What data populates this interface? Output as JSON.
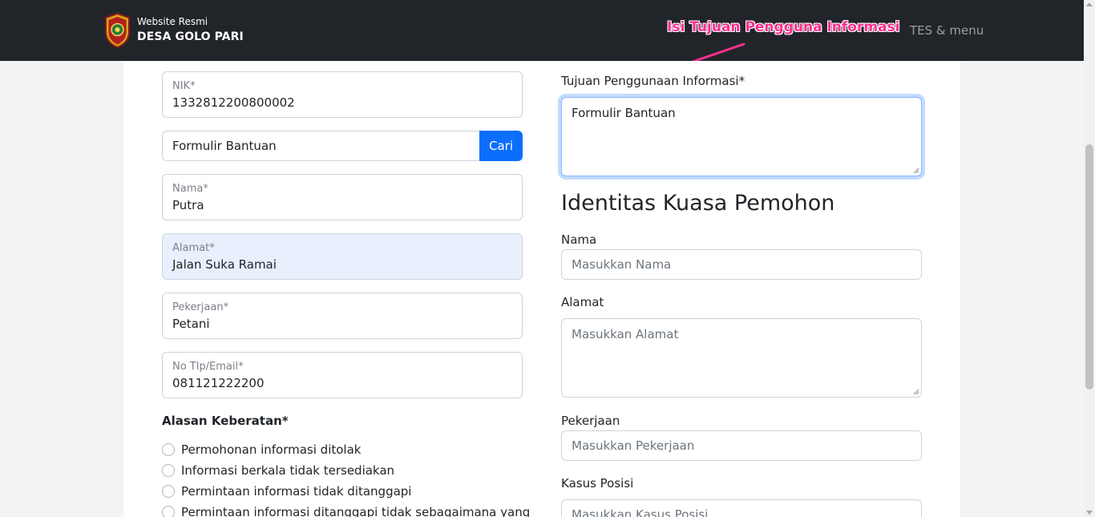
{
  "navbar": {
    "brand_small": "Website Resmi",
    "brand_big": "DESA GOLO PARI",
    "menu": "TES & menu"
  },
  "annotation": {
    "text": "Isi Tujuan Pengguna Informasi",
    "color": "#ff2d8f"
  },
  "left_form": {
    "nik": {
      "label": "NIK*",
      "value": "1332812200800002"
    },
    "search": {
      "value": "Formulir Bantuan",
      "button": "Cari"
    },
    "nama": {
      "label": "Nama*",
      "value": "Putra"
    },
    "alamat": {
      "label": "Alamat*",
      "value": "Jalan Suka Ramai"
    },
    "pekerjaan": {
      "label": "Pekerjaan*",
      "value": "Petani"
    },
    "kontak": {
      "label": "No Tlp/Email*",
      "value": "081121222200"
    },
    "alasan": {
      "label": "Alasan Keberatan*",
      "options": [
        "Permohonan informasi ditolak",
        "Informasi berkala tidak tersediakan",
        "Permintaan informasi tidak ditanggapi",
        "Permintaan informasi ditanggapi tidak sebagaimana yang"
      ]
    }
  },
  "right_form": {
    "tujuan": {
      "label": "Tujuan Penggunaan Informasi*",
      "value": "Formulir Bantuan"
    },
    "kuasa_title": "Identitas Kuasa Pemohon",
    "kuasa_nama": {
      "label": "Nama",
      "placeholder": "Masukkan Nama"
    },
    "kuasa_alamat": {
      "label": "Alamat",
      "placeholder": "Masukkan Alamat"
    },
    "kuasa_pekerjaan": {
      "label": "Pekerjaan",
      "placeholder": "Masukkan Pekerjaan"
    },
    "kuasa_posisi": {
      "label": "Kasus Posisi",
      "placeholder": "Masukkan Kasus Posisi"
    }
  },
  "colors": {
    "navbar_bg": "#212529",
    "primary": "#0d6efd",
    "autofill_bg": "#e8f0fe"
  }
}
